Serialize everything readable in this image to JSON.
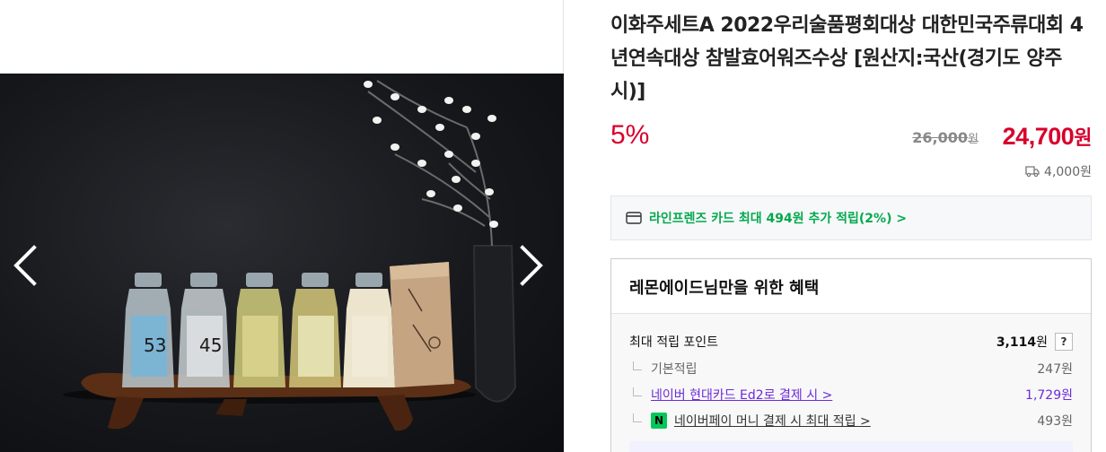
{
  "product": {
    "title": "이화주세트A 2022우리술품평회대상 대한민국주류대회 4년연속대상 참발효어워즈수상 [원산지:국산(경기도 양주시)]",
    "discount": "5%",
    "original_price": "26,000",
    "original_price_unit": "원",
    "sale_price": "24,700",
    "sale_price_unit": "원",
    "shipping_fee": "4,000원",
    "icons": {
      "shipping": "truck-icon",
      "card": "credit-card-icon",
      "prev": "chevron-left-icon",
      "next": "chevron-right-icon"
    },
    "colors": {
      "price": "#d8002c",
      "card_text": "#03a94d",
      "link": "#6c2bd9",
      "npay": "#03c75a"
    }
  },
  "card_banner": {
    "text": "라인프렌즈 카드 최대 494원 추가 적립(2%) >"
  },
  "benefits": {
    "header": "레몬에이드님만을 위한 혜택",
    "max_points_label": "최대 적립 포인트",
    "max_points_value": "3,114",
    "max_points_unit": "원",
    "help": "?",
    "items": [
      {
        "label": "기본적립",
        "value": "247원"
      },
      {
        "label": "네이버 현대카드 Ed2로 결제 시 >",
        "value": "1,729원"
      },
      {
        "label": "네이버페이 머니 결제 시 최대 적립 >",
        "value": "493원",
        "badge": "N"
      }
    ]
  },
  "gallery": {
    "bottle_labels": [
      "53",
      "45",
      "",
      "",
      ""
    ]
  }
}
